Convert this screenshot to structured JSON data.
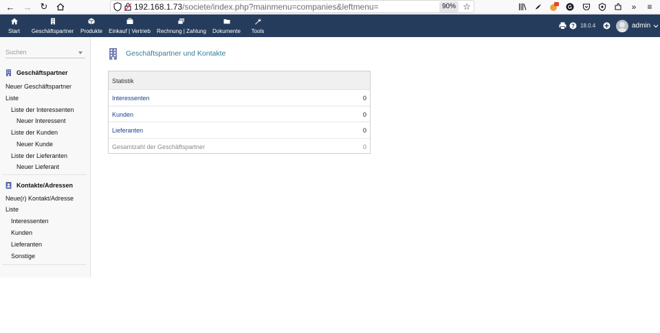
{
  "browser": {
    "url_host": "192.168.1.73",
    "url_path": "/societe/index.php?mainmenu=companies&leftmenu=",
    "zoom": "90%"
  },
  "topmenu": {
    "items": [
      {
        "label": "Start",
        "icon": "home-icon"
      },
      {
        "label": "Geschäftspartner",
        "icon": "building-icon"
      },
      {
        "label": "Produkte",
        "icon": "cube-icon"
      },
      {
        "label": "Einkauf | Vertrieb",
        "icon": "briefcase-icon"
      },
      {
        "label": "Rechnung | Zahlung",
        "icon": "money-icon"
      },
      {
        "label": "Dokumente",
        "icon": "folder-icon"
      },
      {
        "label": "Tools",
        "icon": "wrench-icon"
      }
    ],
    "version": "18.0.4",
    "user": "admin",
    "bg_color": "#263c5c"
  },
  "sidebar": {
    "search_placeholder": "Suchen",
    "sections": [
      {
        "title": "Geschäftspartner",
        "icon": "building-icon",
        "links": [
          "Neuer Geschäftspartner",
          "Liste",
          "Liste der Interessenten",
          "Neuer Interessent",
          "Liste der Kunden",
          "Neuer Kunde",
          "Liste der Lieferanten",
          "Neuer Lieferant"
        ]
      },
      {
        "title": "Kontakte/Adressen",
        "icon": "address-card-icon",
        "links": [
          "Neue(r) Kontakt/Adresse",
          "Liste",
          "Interessenten",
          "Kunden",
          "Lieferanten",
          "Sonstige"
        ]
      }
    ]
  },
  "main": {
    "title": "Geschäftspartner und Kontakte",
    "title_color": "#2f7e98",
    "stats": {
      "header": "Statistik",
      "rows": [
        {
          "label": "Interessenten",
          "value": "0"
        },
        {
          "label": "Kunden",
          "value": "0"
        },
        {
          "label": "Lieferanten",
          "value": "0"
        },
        {
          "label": "Gesamtzahl der Geschäftspartner",
          "value": "0"
        }
      ]
    }
  }
}
